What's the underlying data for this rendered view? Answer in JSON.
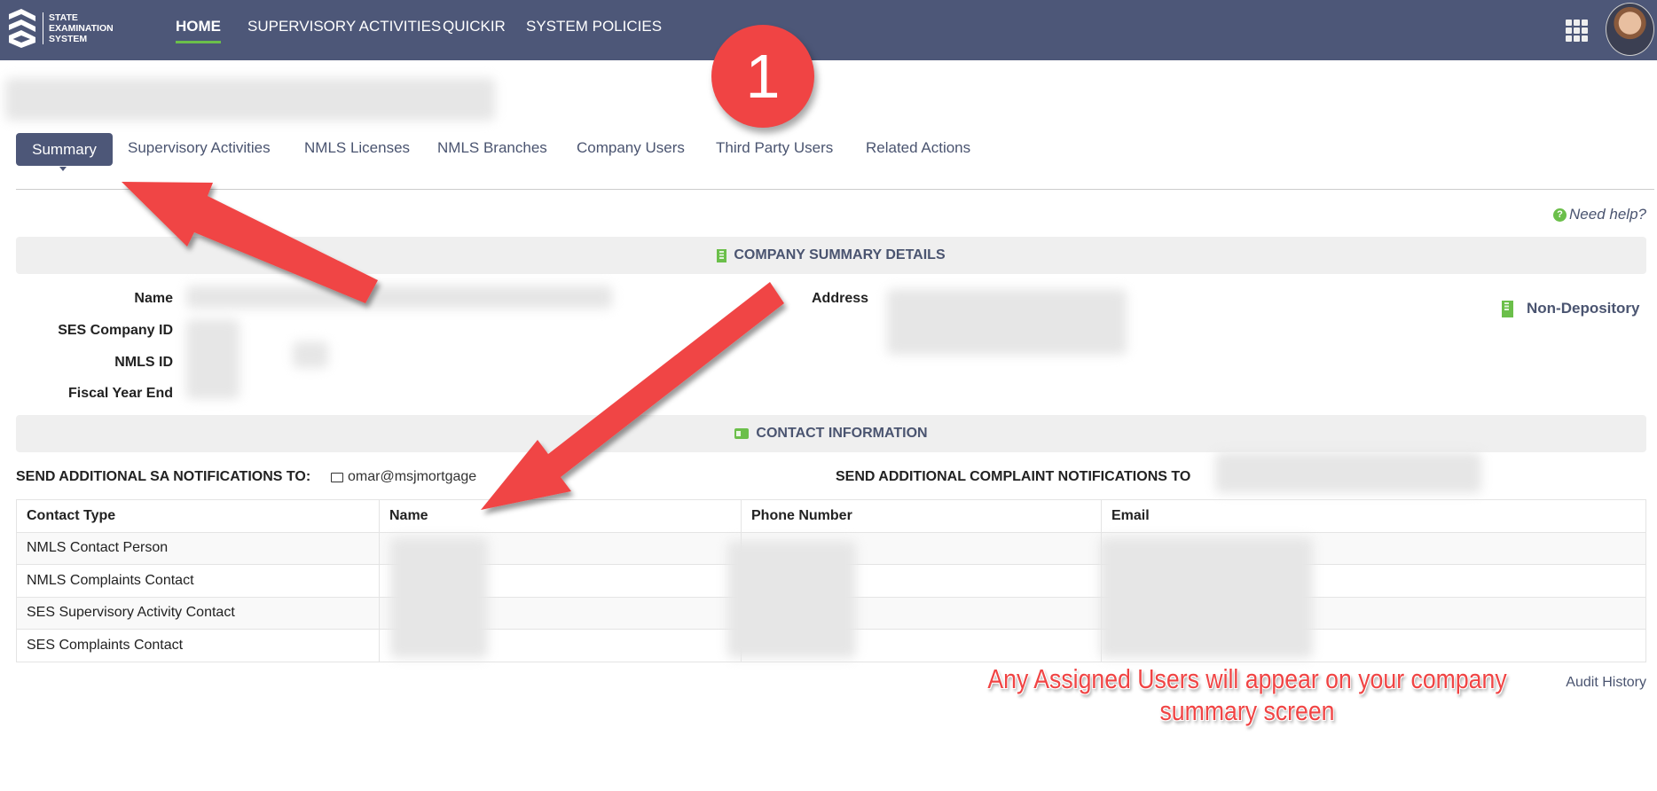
{
  "nav": {
    "logo_text": [
      "STATE",
      "EXAMINATION",
      "SYSTEM"
    ],
    "items": [
      {
        "label": "HOME",
        "active": true
      },
      {
        "label": "SUPERVISORY ACTIVITIES"
      },
      {
        "label": "QUICKIR"
      },
      {
        "label": "SYSTEM POLICIES"
      }
    ],
    "apps_icon": "grid-icon",
    "avatar": "user-avatar"
  },
  "step_badge": "1",
  "tabs": [
    {
      "label": "Summary",
      "active": true
    },
    {
      "label": "Supervisory Activities"
    },
    {
      "label": "NMLS Licenses"
    },
    {
      "label": "NMLS Branches"
    },
    {
      "label": "Company Users"
    },
    {
      "label": "Third Party Users"
    },
    {
      "label": "Related Actions"
    }
  ],
  "help_link": "Need help?",
  "company_summary": {
    "header": "COMPANY SUMMARY DETAILS",
    "fields": [
      "Name",
      "SES Company ID",
      "NMLS ID",
      "Fiscal Year End"
    ],
    "address_label": "Address",
    "type": "Non-Depository"
  },
  "contact_info": {
    "header": "CONTACT INFORMATION",
    "sa_notifications_label": "SEND ADDITIONAL SA NOTIFICATIONS TO:",
    "sa_notifications_email": "omar@msjmortgage",
    "complaint_notifications_label": "SEND ADDITIONAL COMPLAINT NOTIFICATIONS TO",
    "table": {
      "columns": [
        "Contact Type",
        "Name",
        "Phone Number",
        "Email"
      ],
      "rows": [
        [
          "NMLS Contact Person",
          "",
          "",
          ""
        ],
        [
          "NMLS Complaints Contact",
          "",
          "",
          ""
        ],
        [
          "SES Supervisory Activity Contact",
          "",
          "",
          ""
        ],
        [
          "SES Complaints Contact",
          "",
          "",
          ""
        ]
      ]
    }
  },
  "audit_history": "Audit History",
  "annotation": {
    "line1": "Any Assigned Users will appear on your company",
    "line2": "summary screen"
  },
  "colors": {
    "nav": "#4d5778",
    "accent_green": "#6bbf4a",
    "annotation_red": "#f04444"
  }
}
